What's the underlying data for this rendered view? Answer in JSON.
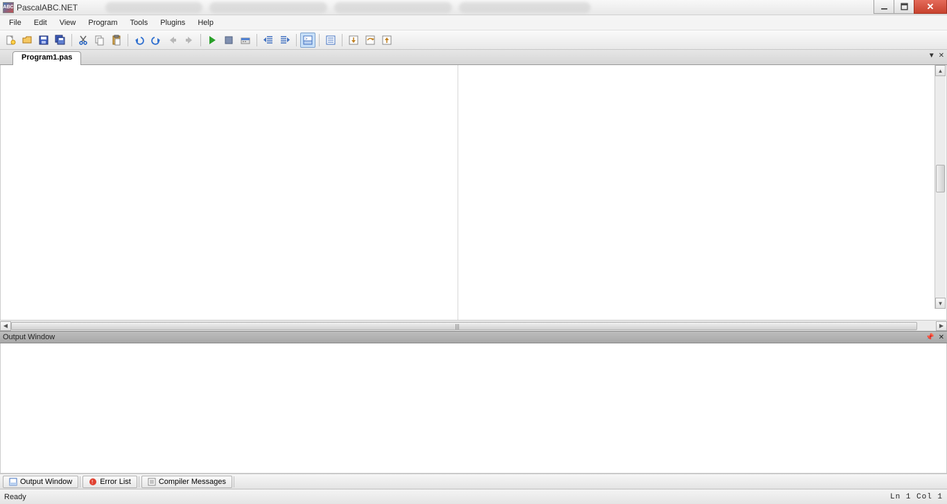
{
  "window": {
    "title": "PascalABC.NET",
    "icon_text": "ABC"
  },
  "menu": {
    "items": [
      "File",
      "Edit",
      "View",
      "Program",
      "Tools",
      "Plugins",
      "Help"
    ]
  },
  "toolbar": {
    "groups": [
      [
        "new-file",
        "open-file",
        "save-file",
        "save-all"
      ],
      [
        "cut",
        "copy",
        "paste"
      ],
      [
        "undo",
        "redo",
        "nav-back",
        "nav-forward"
      ],
      [
        "run",
        "stop",
        "build"
      ],
      [
        "outdent",
        "indent"
      ],
      [
        "toggle-output",
        "toggle-panel"
      ],
      [
        "debug-step-into",
        "debug-step-over",
        "debug-step-out"
      ]
    ],
    "active": "toggle-output"
  },
  "tabs": {
    "documents": [
      "Program1.pas"
    ],
    "active": 0
  },
  "output_panel": {
    "title": "Output Window"
  },
  "bottom_tabs": {
    "items": [
      "Output Window",
      "Error List",
      "Compiler Messages"
    ]
  },
  "status": {
    "left": "Ready",
    "right": "Ln 1 Col 1"
  }
}
